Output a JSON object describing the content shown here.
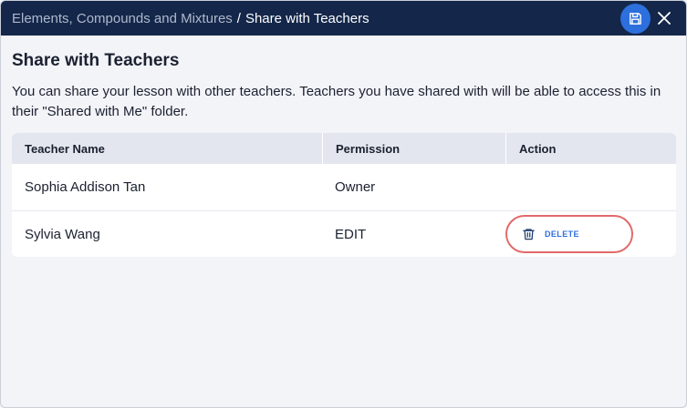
{
  "header": {
    "breadcrumb_parent": "Elements, Compounds and Mixtures",
    "breadcrumb_separator": "/",
    "breadcrumb_current": "Share with Teachers"
  },
  "page": {
    "title": "Share with Teachers",
    "description": "You can share your lesson with other teachers. Teachers you have shared with will be able to access this in their \"Shared with Me\" folder."
  },
  "table": {
    "columns": [
      "Teacher Name",
      "Permission",
      "Action"
    ],
    "rows": [
      {
        "name": "Sophia Addison Tan",
        "permission": "Owner",
        "action": ""
      },
      {
        "name": "Sylvia Wang",
        "permission": "EDIT",
        "action": "DELETE"
      }
    ]
  },
  "colors": {
    "header_bg": "#14274a",
    "accent": "#2d6fdc",
    "highlight_ring": "#e26a6a",
    "background": "#f3f4f8"
  },
  "icons": {
    "save": "floppy-disk-icon",
    "close": "close-icon",
    "delete": "trash-icon"
  }
}
